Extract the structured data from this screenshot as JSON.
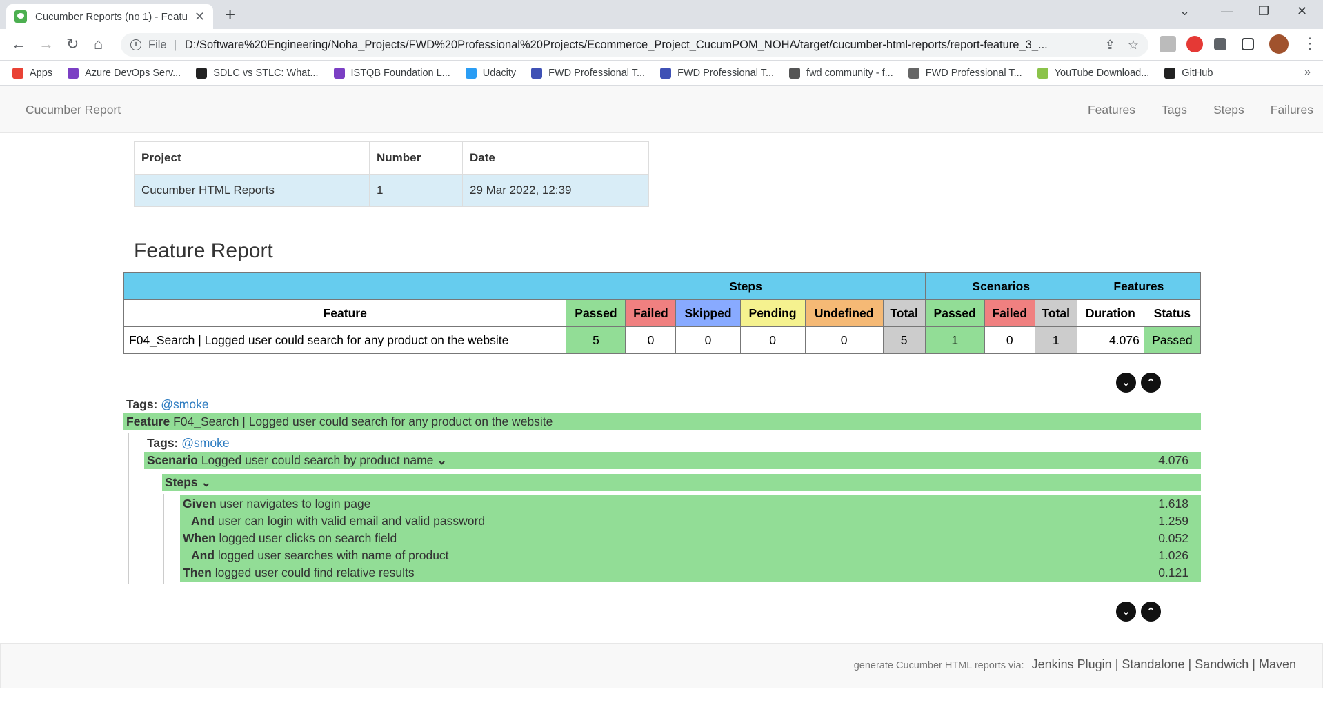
{
  "browser": {
    "tab_title": "Cucumber Reports (no 1) - Featu",
    "url_scheme": "File",
    "url": "D:/Software%20Engineering/Noha_Projects/FWD%20Professional%20Projects/Ecommerce_Project_CucumPOM_NOHA/target/cucumber-html-reports/report-feature_3_...",
    "bookmarks": [
      "Apps",
      "Azure DevOps Serv...",
      "SDLC vs STLC: What...",
      "ISTQB Foundation L...",
      "Udacity",
      "FWD Professional T...",
      "FWD Professional T...",
      "fwd community - f...",
      "FWD Professional T...",
      "YouTube Download...",
      "GitHub"
    ],
    "bookmark_colors": [
      "#e94235",
      "#7b3fc4",
      "#222222",
      "#7b3fc4",
      "#2a9df4",
      "#3f51b5",
      "#3f51b5",
      "#555555",
      "#666666",
      "#8bc34a",
      "#222222"
    ]
  },
  "nav": {
    "brand": "Cucumber Report",
    "links": [
      "Features",
      "Tags",
      "Steps",
      "Failures"
    ]
  },
  "project_table": {
    "headers": [
      "Project",
      "Number",
      "Date"
    ],
    "row": [
      "Cucumber HTML Reports",
      "1",
      "29 Mar 2022, 12:39"
    ]
  },
  "report_title": "Feature Report",
  "stats": {
    "group_headers": [
      "Steps",
      "Scenarios",
      "Features"
    ],
    "columns": [
      "Feature",
      "Passed",
      "Failed",
      "Skipped",
      "Pending",
      "Undefined",
      "Total",
      "Passed",
      "Failed",
      "Total",
      "Duration",
      "Status"
    ],
    "row": [
      "F04_Search | Logged user could search for any product on the website",
      "5",
      "0",
      "0",
      "0",
      "0",
      "5",
      "1",
      "0",
      "1",
      "4.076",
      "Passed"
    ]
  },
  "feature": {
    "tags_label": "Tags:",
    "tag": "@smoke",
    "keyword": "Feature",
    "name": "F04_Search | Logged user could search for any product on the website",
    "scenario": {
      "tags_label": "Tags:",
      "tag": "@smoke",
      "keyword": "Scenario",
      "name": "Logged user could search by product name",
      "duration": "4.076",
      "steps_label": "Steps",
      "steps": [
        {
          "keyword": "Given",
          "text": "user navigates to login page",
          "duration": "1.618"
        },
        {
          "keyword": "And",
          "text": "user can login with valid email and valid password",
          "duration": "1.259"
        },
        {
          "keyword": "When",
          "text": "logged user clicks on search field",
          "duration": "0.052"
        },
        {
          "keyword": "And",
          "text": "logged user searches with name of product",
          "duration": "1.026"
        },
        {
          "keyword": "Then",
          "text": "logged user could find relative results",
          "duration": "0.121"
        }
      ]
    }
  },
  "footer": {
    "prefix": "generate Cucumber HTML reports via:",
    "links": [
      "Jenkins Plugin",
      "Standalone",
      "Sandwich",
      "Maven"
    ],
    "separator": "|"
  }
}
